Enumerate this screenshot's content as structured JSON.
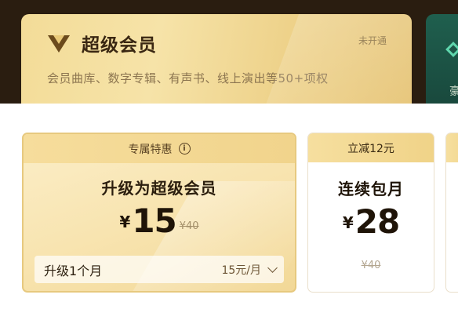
{
  "membership": {
    "title": "超级会员",
    "status": "未开通",
    "description": "会员曲库、数字专辑、有声书、线上演出等50+项权",
    "logo_icon": "v-diamond-icon",
    "peek_char": "豪"
  },
  "plans": [
    {
      "badge": "专属特惠",
      "badge_icon": "info-icon",
      "name": "升级为超级会员",
      "currency": "¥",
      "price": "15",
      "original_price": "¥40",
      "period_label": "升级1个月",
      "period_price": "15元/月",
      "selected": true
    },
    {
      "badge": "立减12元",
      "name": "连续包月",
      "currency": "¥",
      "price": "28",
      "original_price": "¥40",
      "selected": false
    }
  ],
  "colors": {
    "top_bg": "#2a1d10",
    "gold_card": "#f3dc98",
    "green_card": "#1f5f4e",
    "selected_border": "#e7c97f"
  }
}
